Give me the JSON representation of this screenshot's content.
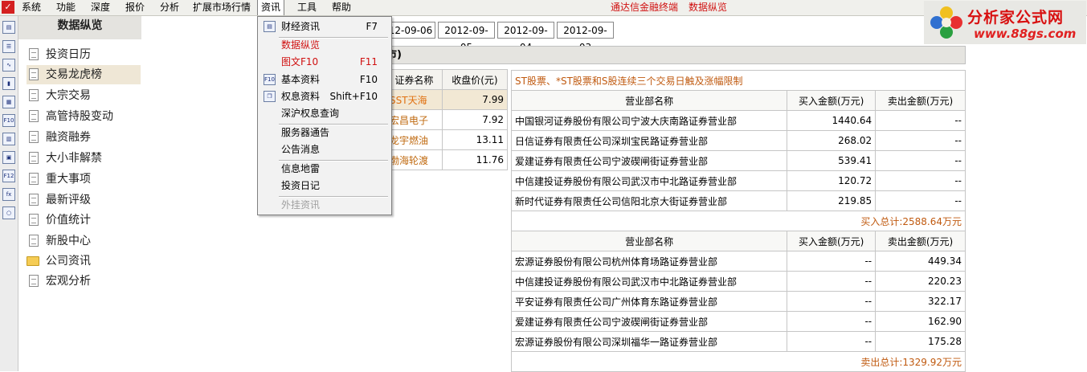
{
  "menubar": {
    "items": [
      "系统",
      "功能",
      "深度",
      "报价",
      "分析",
      "扩展市场行情",
      "资讯",
      "工具",
      "帮助"
    ],
    "title_left": "通达信金融终端",
    "title_right": "数据纵览"
  },
  "logo": {
    "name": "分析家公式网",
    "url": "www.88gs.com"
  },
  "sidebar": {
    "title": "数据纵览",
    "items": [
      "投资日历",
      "交易龙虎榜",
      "大宗交易",
      "高管持股变动",
      "融资融券",
      "大小非解禁",
      "重大事项",
      "最新评级",
      "价值统计",
      "新股中心",
      "公司资讯",
      "宏观分析"
    ]
  },
  "dropdown": {
    "items": [
      {
        "label": "财经资讯",
        "key": "F7"
      },
      {
        "label": "数据纵览",
        "key": ""
      },
      {
        "label": "图文F10",
        "key": "F11"
      },
      {
        "label": "基本资料",
        "key": "F10"
      },
      {
        "label": "权息资料",
        "key": "Shift+F10"
      },
      {
        "label": "深沪权息查询",
        "key": ""
      },
      {
        "label": "服务器通告",
        "key": ""
      },
      {
        "label": "公告消息",
        "key": ""
      },
      {
        "label": "信息地雷",
        "key": ""
      },
      {
        "label": "投资日记",
        "key": ""
      },
      {
        "label": "外挂资讯",
        "key": ""
      }
    ]
  },
  "dates": [
    "12-09-06",
    "2012-09-05",
    "2012-09-04",
    "2012-09-03"
  ],
  "band_title": "市)",
  "stocks": {
    "headers": [
      "证券名称",
      "收盘价(元)"
    ],
    "rows": [
      {
        "name": "SST天海",
        "price": "7.99"
      },
      {
        "name": "宏昌电子",
        "price": "7.92"
      },
      {
        "name": "龙宇燃油",
        "price": "13.11"
      },
      {
        "name": "渤海轮渡",
        "price": "11.76"
      }
    ]
  },
  "lhb": {
    "caption": "ST股票、*ST股票和S股连续三个交易日触及涨幅限制",
    "headers": [
      "营业部名称",
      "买入金额(万元)",
      "卖出金额(万元)"
    ],
    "buy_rows": [
      {
        "name": "中国银河证券股份有限公司宁波大庆南路证券营业部",
        "buy": "1440.64",
        "sell": "--"
      },
      {
        "name": "日信证券有限责任公司深圳宝民路证券营业部",
        "buy": "268.02",
        "sell": "--"
      },
      {
        "name": "爱建证券有限责任公司宁波碶闸街证券营业部",
        "buy": "539.41",
        "sell": "--"
      },
      {
        "name": "中信建投证券股份有限公司武汉市中北路证券营业部",
        "buy": "120.72",
        "sell": "--"
      },
      {
        "name": "新时代证券有限责任公司信阳北京大街证券营业部",
        "buy": "219.85",
        "sell": "--"
      }
    ],
    "buy_total": "买入总计:2588.64万元",
    "sell_rows": [
      {
        "name": "宏源证券股份有限公司杭州体育场路证券营业部",
        "buy": "--",
        "sell": "449.34"
      },
      {
        "name": "中信建投证券股份有限公司武汉市中北路证券营业部",
        "buy": "--",
        "sell": "220.23"
      },
      {
        "name": "平安证券有限责任公司广州体育东路证券营业部",
        "buy": "--",
        "sell": "322.17"
      },
      {
        "name": "爱建证券有限责任公司宁波碶闸街证券营业部",
        "buy": "--",
        "sell": "162.90"
      },
      {
        "name": "宏源证券股份有限公司深圳福华一路证券营业部",
        "buy": "--",
        "sell": "175.28"
      }
    ],
    "sell_total": "卖出总计:1329.92万元"
  },
  "colors": {
    "accent_red": "#d01010",
    "orange_text": "#c05a10",
    "selected_row": "#efe7d6"
  }
}
